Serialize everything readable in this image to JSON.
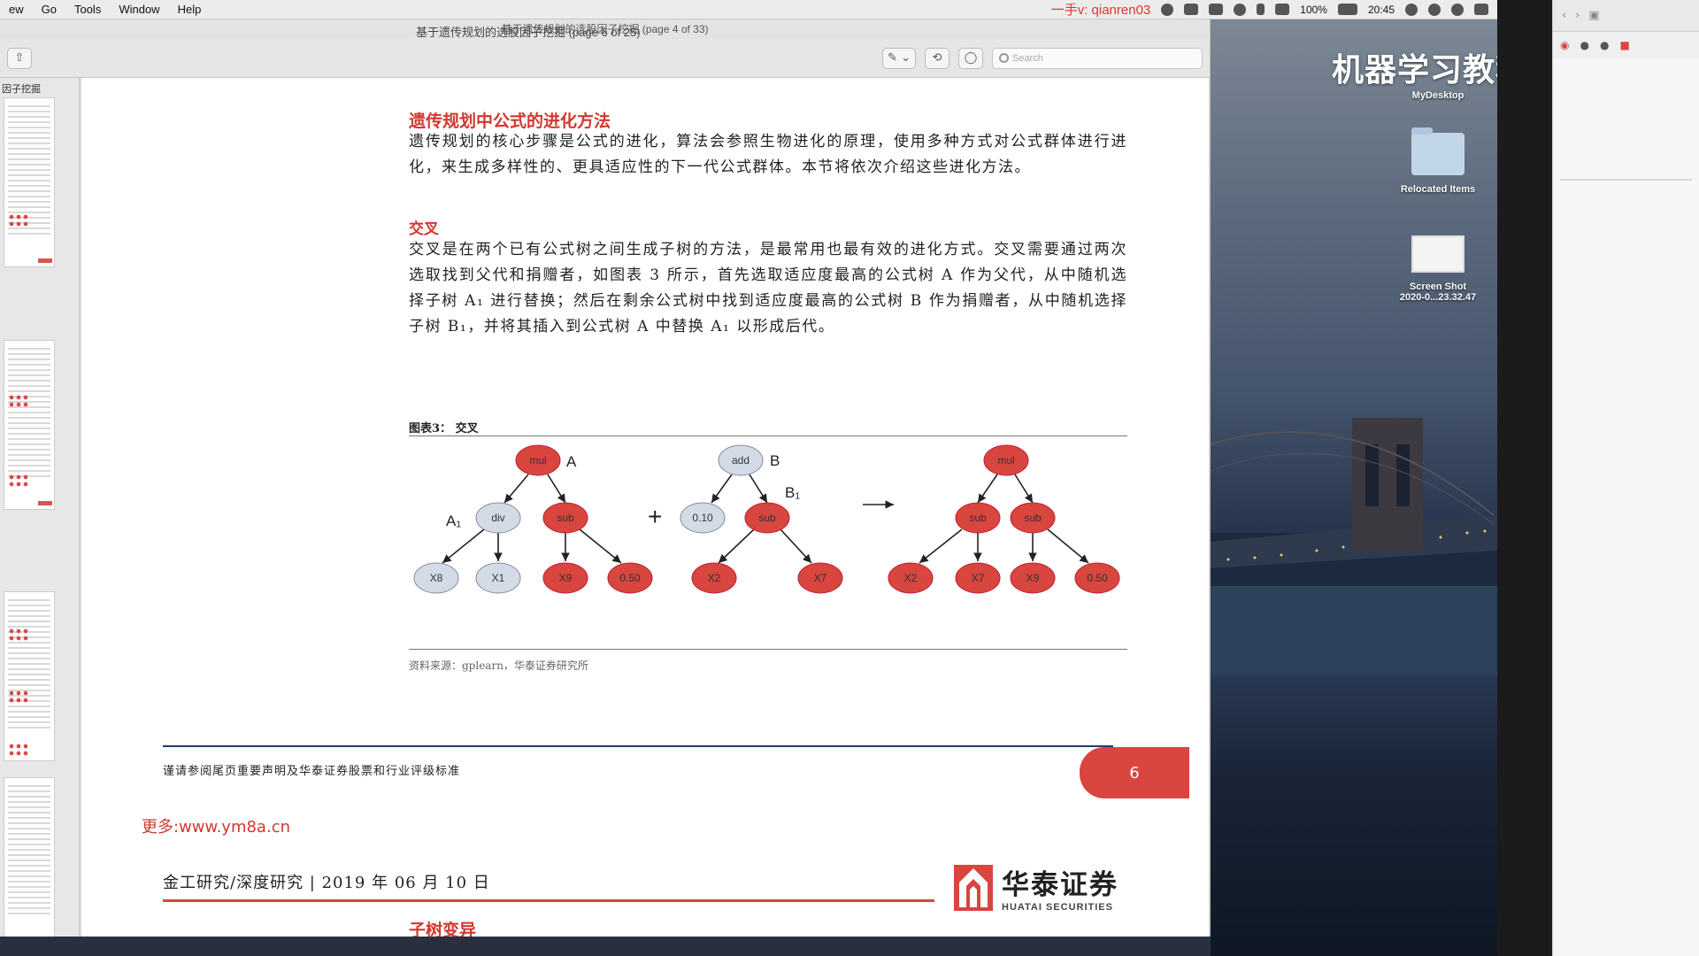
{
  "menubar": {
    "items": [
      "ew",
      "Go",
      "Tools",
      "Window",
      "Help"
    ],
    "watermark": "一手v: qianren03",
    "battery": "100%",
    "clock": "20:45"
  },
  "window": {
    "title_back": "基于遗传规划的选股因子挖掘 (page 4 of 33)",
    "title": "基于遗传规划的选股因子挖掘 (page 6 of 25)",
    "search_placeholder": "Search",
    "sidebar_label": "因子挖掘"
  },
  "page": {
    "section_title": "遗传规划中公式的进化方法",
    "intro": "遗传规划的核心步骤是公式的进化，算法会参照生物进化的原理，使用多种方式对公式群体进行进化，来生成多样性的、更具适应性的下一代公式群体。本节将依次介绍这些进化方法。",
    "sub_title": "交叉",
    "body": "交叉是在两个已有公式树之间生成子树的方法，是最常用也最有效的进化方式。交叉需要通过两次选取找到父代和捐赠者，如图表 3 所示，首先选取适应度最高的公式树 A 作为父代，从中随机选择子树 A₁ 进行替换；然后在剩余公式树中找到适应度最高的公式树 B 作为捐赠者，从中随机选择子树 B₁，并将其插入到公式树 A 中替换 A₁ 以形成后代。",
    "figure_caption": "图表3：  交叉",
    "figure_source": "资料来源：gplearn，华泰证券研究所",
    "footer_note": "谨请参阅尾页重要声明及华泰证券股票和行业评级标准",
    "page_number": "6",
    "more_link": "更多:www.ym8a.cn",
    "next_header": "金工研究/深度研究  | 2019 年 06 月 10 日",
    "logo_cn": "华泰证券",
    "logo_en": "HUATAI SECURITIES",
    "next_heading": "子树变异"
  },
  "tree": {
    "labels": {
      "a": "A",
      "a1": "A₁",
      "b": "B",
      "b1": "B₁",
      "plus": "+",
      "arrow": "→"
    },
    "treeA": {
      "root": "mul",
      "left": "div",
      "right": "sub",
      "ll": "X8",
      "lr": "X1",
      "rl": "X9",
      "rr": "0.50"
    },
    "treeB": {
      "root": "add",
      "left": "0.10",
      "right": "sub",
      "rl": "X2",
      "rr": "X7"
    },
    "treeC": {
      "root": "mul",
      "left": "sub",
      "right": "sub",
      "ll": "X2",
      "lr": "X7",
      "rl": "X9",
      "rr": "0.50"
    }
  },
  "desktop": {
    "title": "机器学习教程",
    "mydesktop": "MyDesktop",
    "folder_label": "Relocated Items",
    "shot_label_1": "Screen Shot",
    "shot_label_2": "2020-0...23.32.47"
  },
  "colors": {
    "red": "#d9453f",
    "grey_node": "#d3dbe6",
    "navy": "#243b6e"
  }
}
